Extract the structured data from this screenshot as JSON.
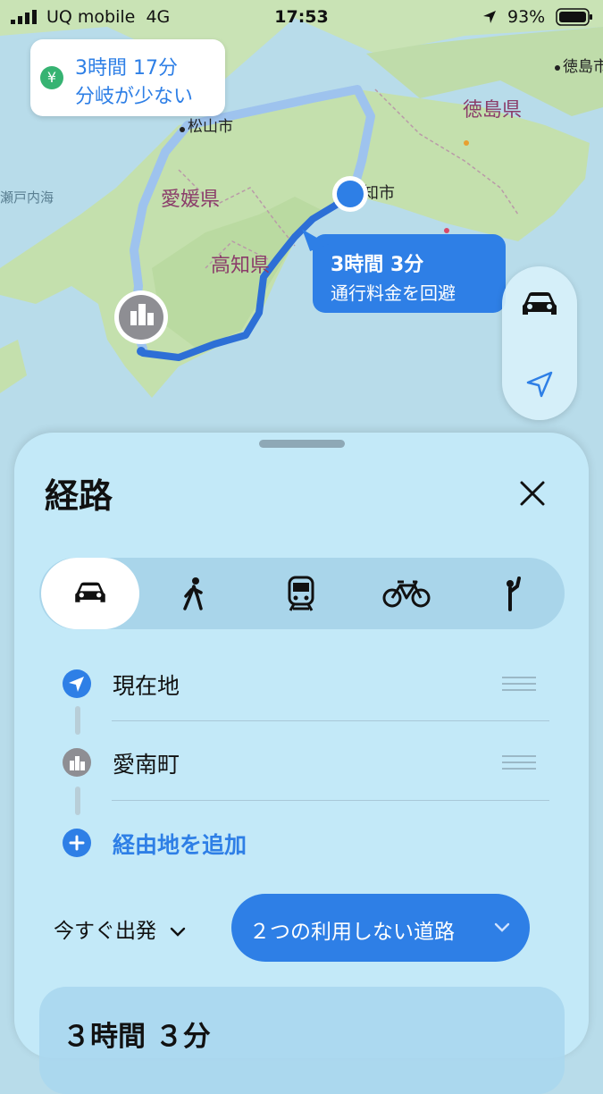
{
  "status_bar": {
    "carrier": "UQ mobile",
    "network": "4G",
    "time": "17:53",
    "battery": "93%"
  },
  "map": {
    "labels": {
      "matsuyama": "松山市",
      "ehime": "愛媛県",
      "kochi_pref": "高知県",
      "tokushima_pref": "徳島県",
      "tokushima_city": "徳島市",
      "kochi_city": "知市",
      "setonaikai": "瀬戸内海"
    },
    "alt_route": {
      "time": "3時間 17分",
      "note": "分岐が少ない"
    },
    "main_route": {
      "time": "3時間 3分",
      "note": "通行料金を回避"
    }
  },
  "sheet": {
    "title": "経路",
    "waypoints": [
      {
        "label": "現在地",
        "icon": "location-arrow-icon"
      },
      {
        "label": "愛南町",
        "icon": "city-icon"
      }
    ],
    "add_stop": "経由地を追加",
    "depart": "今すぐ出発",
    "avoid": "２つの利用しない道路",
    "result_time": "３時間 ３分"
  },
  "colors": {
    "accent": "#2e7fe6",
    "route": "#2d6fd6",
    "alt_route": "#9ec3ee",
    "green": "#36b372"
  }
}
